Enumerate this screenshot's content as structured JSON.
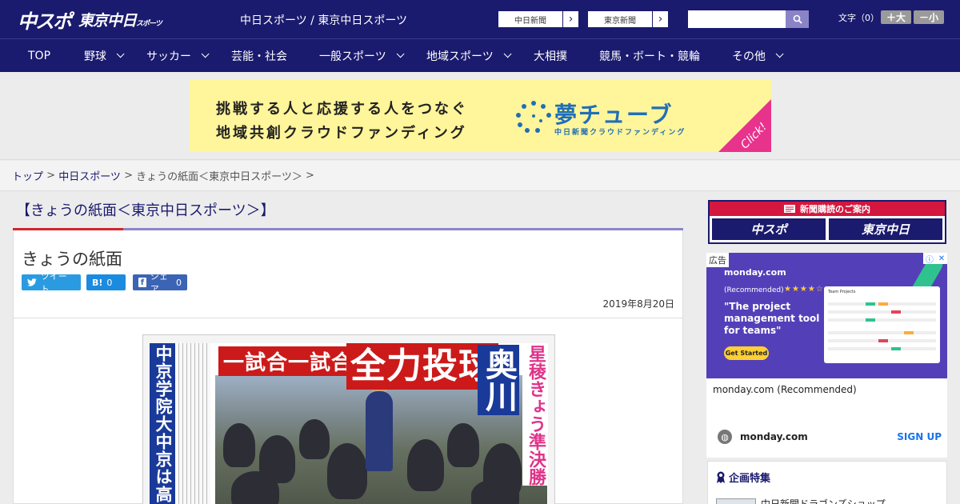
{
  "header": {
    "logo_main": "中スポ",
    "logo_tokyo": "東京中日",
    "logo_tokyo_sub": "スポーツ",
    "site_title": "中日スポーツ / 東京中日スポーツ",
    "links": [
      {
        "label": "中日新聞",
        "arrow": "›"
      },
      {
        "label": "東京新聞",
        "arrow": "›"
      }
    ],
    "search_placeholder": "",
    "font_label": "文字（0）",
    "font_up": "＋大",
    "font_down": "－小"
  },
  "nav": [
    {
      "label": "TOP",
      "dropdown": false
    },
    {
      "label": "野球",
      "dropdown": true
    },
    {
      "label": "サッカー",
      "dropdown": true
    },
    {
      "label": "芸能・社会",
      "dropdown": false
    },
    {
      "label": "一般スポーツ",
      "dropdown": true
    },
    {
      "label": "地域スポーツ",
      "dropdown": true
    },
    {
      "label": "大相撲",
      "dropdown": false
    },
    {
      "label": "競馬・ボート・競輪",
      "dropdown": false
    },
    {
      "label": "その他",
      "dropdown": true
    }
  ],
  "banner": {
    "line1": "挑戦する人と応援する人をつなぐ",
    "line2": "地域共創クラウドファンディング",
    "brand": "夢チューブ",
    "brand_sub": "中日新聞クラウドファンディング",
    "click": "Click!"
  },
  "breadcrumb": {
    "home": "トップ",
    "sep": " > ",
    "section": "中日スポーツ",
    "current": "きょうの紙面＜東京中日スポーツ＞",
    "tail": " >"
  },
  "main": {
    "page_heading": "【きょうの紙面＜東京中日スポーツ＞】",
    "article_title": "きょうの紙面",
    "share": {
      "tweet": "ツイート",
      "hatena_icon": "B!",
      "hatena_count": "0",
      "fb_icon": "f",
      "fb_label": "シェア",
      "fb_count": "0"
    },
    "date": "2019年8月20日"
  },
  "paper": {
    "left_band": "中京学院大中京は高架下「必勝",
    "headline_small": "一試合一試合",
    "headline_big": "全力投球",
    "name": "奥川",
    "pink": "星稜きょう準決勝"
  },
  "sidebar": {
    "subscribe_head": "新聞購読のご案内",
    "logo1": "中スポ",
    "logo2": "東京中日",
    "ad_label": "広告",
    "ad_close_i": "ⓘ",
    "ad_close_x": "✕",
    "ad_brand": "monday.com",
    "ad_recommended": "(Recommended)",
    "ad_stars": "★★★★☆",
    "ad_headline": "\"The project management tool for teams\"",
    "ad_cta": "Get Started",
    "ad_mock_title": "Team Projects",
    "ad_caption": "monday.com (Recommended)",
    "ad_domain": "monday.com",
    "ad_signup": "SIGN UP",
    "feature_title": "企画特集",
    "feature_item": "中日新聞ドラゴンズショップ"
  },
  "colors": {
    "header_bg": "#1a1a6e",
    "accent_red": "#d0262b",
    "banner_yellow": "#fff59a",
    "banner_blue": "#1f6fb8",
    "ad_purple": "#5340b9"
  }
}
